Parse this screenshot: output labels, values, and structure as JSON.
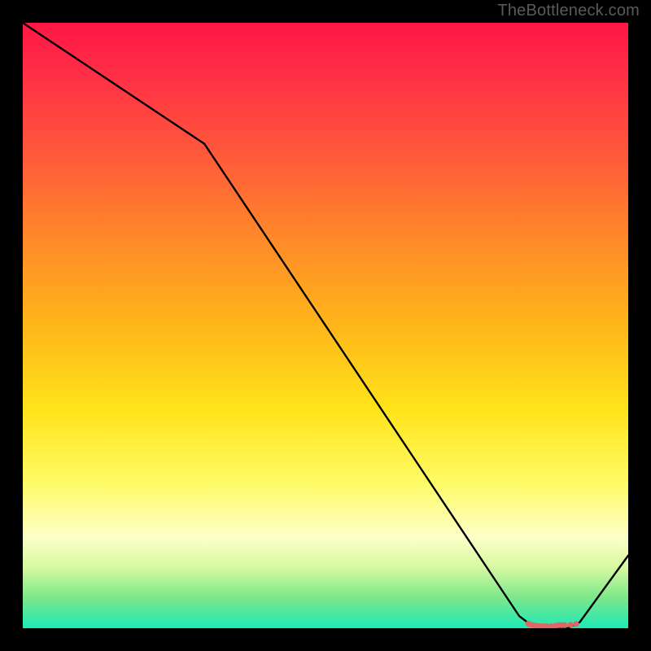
{
  "attribution": "TheBottleneck.com",
  "chart_data": {
    "type": "line",
    "title": "",
    "xlabel": "",
    "ylabel": "",
    "xlim": [
      0,
      100
    ],
    "ylim": [
      0,
      100
    ],
    "grid": false,
    "legend": false,
    "series": [
      {
        "name": "curve",
        "x": [
          0,
          30,
          82,
          84,
          86,
          88,
          90,
          91,
          92,
          100
        ],
        "values": [
          100,
          80,
          2,
          0.5,
          0,
          0,
          0,
          0.5,
          1,
          12
        ]
      }
    ],
    "markers": {
      "name": "dots",
      "color": "#e06666",
      "x": [
        83.5,
        83.8,
        84.3,
        84.8,
        85.3,
        85.8,
        86.0,
        86.3,
        86.6,
        87.3,
        88.0,
        88.5,
        89.0,
        89.5,
        90.5,
        91.4
      ],
      "y": [
        0.75,
        0.6,
        0.5,
        0.4,
        0.35,
        0.3,
        0.3,
        0.3,
        0.3,
        0.32,
        0.4,
        0.5,
        0.5,
        0.5,
        0.55,
        0.7
      ]
    },
    "gradient_stops": [
      {
        "pos": 0.0,
        "color": "#ff1744"
      },
      {
        "pos": 0.5,
        "color": "#ffe41a"
      },
      {
        "pos": 0.85,
        "color": "#fdffc9"
      },
      {
        "pos": 1.0,
        "color": "#1de9b6"
      }
    ]
  }
}
